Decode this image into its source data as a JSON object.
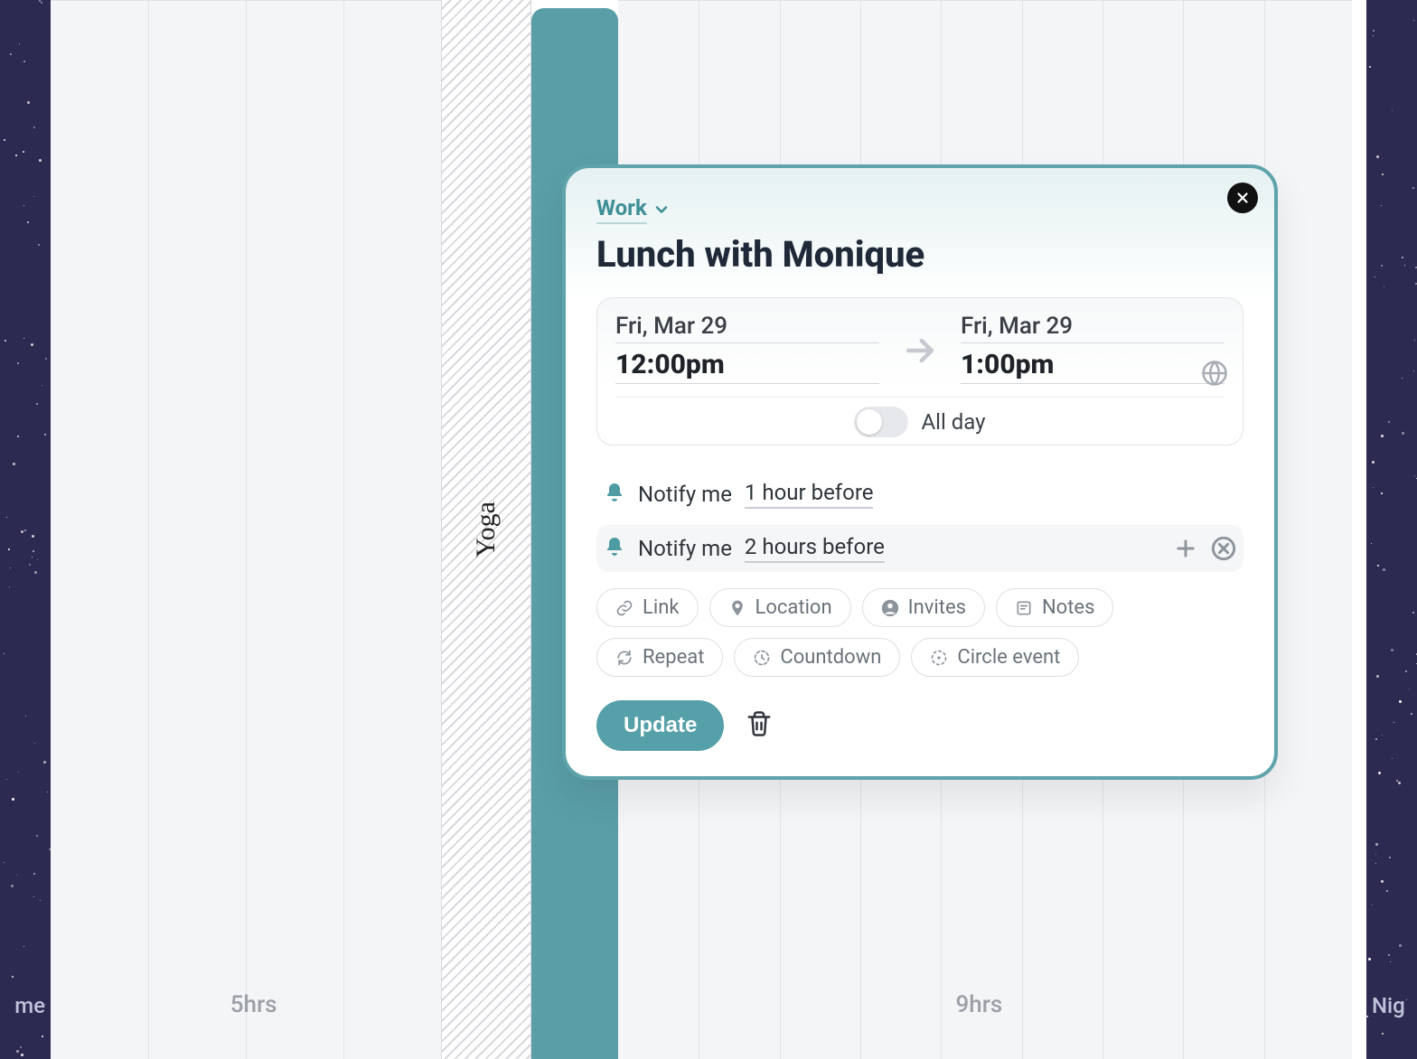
{
  "night": {
    "left_label": "me",
    "right_label": "Nig"
  },
  "days": {
    "left_duration": "5hrs",
    "right_duration": "9hrs"
  },
  "hatched_event": {
    "title": "Yoga"
  },
  "popover": {
    "category": "Work",
    "title": "Lunch with Monique",
    "start": {
      "date": "Fri, Mar 29",
      "time": "12:00pm"
    },
    "end": {
      "date": "Fri, Mar 29",
      "time": "1:00pm"
    },
    "allday_label": "All day",
    "notifications": [
      {
        "prefix": "Notify me",
        "value": "1 hour before"
      },
      {
        "prefix": "Notify me",
        "value": "2 hours before"
      }
    ],
    "chips": {
      "link": "Link",
      "location": "Location",
      "invites": "Invites",
      "notes": "Notes",
      "repeat": "Repeat",
      "countdown": "Countdown",
      "circle": "Circle event"
    },
    "update_label": "Update"
  }
}
